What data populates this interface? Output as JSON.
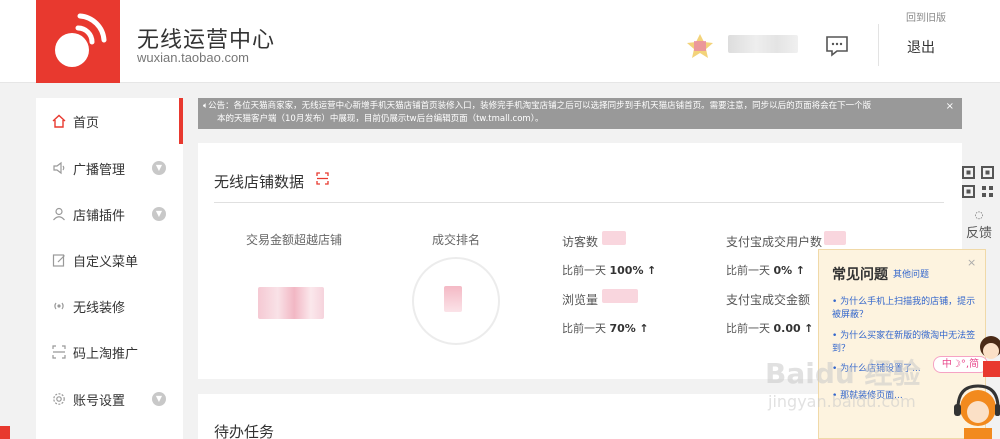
{
  "header": {
    "brand_title": "无线运营中心",
    "brand_sub": "wuxian.taobao.com",
    "old_version": "回到旧版",
    "logout": "退出",
    "brand_color": "#e8392f"
  },
  "sidebar": {
    "items": [
      {
        "label": "首页",
        "icon": "home-icon",
        "active": true,
        "arrow": false
      },
      {
        "label": "广播管理",
        "icon": "speaker-icon",
        "active": false,
        "arrow": true
      },
      {
        "label": "店铺插件",
        "icon": "user-icon",
        "active": false,
        "arrow": true
      },
      {
        "label": "自定义菜单",
        "icon": "edit-icon",
        "active": false,
        "arrow": false
      },
      {
        "label": "无线装修",
        "icon": "wireless-icon",
        "active": false,
        "arrow": false
      },
      {
        "label": "码上淘推广",
        "icon": "scan-icon",
        "active": false,
        "arrow": false
      },
      {
        "label": "账号设置",
        "icon": "gear-icon",
        "active": false,
        "arrow": true
      }
    ]
  },
  "notice": {
    "icon": "speaker-icon",
    "line1": "公告：各位天猫商家家，无线运营中心新增手机天猫店铺首页装修入口，装修完手机淘宝店铺之后可以选择同步到手机天猫店铺首页。需要注意，同步以后的页面将会在下一个版",
    "line2": "本的天猫客户端（10月发布）中展现，目前仍展示tw后台编辑页面（tw.tmall.com）。",
    "close": "×"
  },
  "store_data": {
    "title": "无线店铺数据",
    "exceed_title": "交易金额超越店铺",
    "rank_title": "成交排名",
    "metrics": [
      {
        "label": "访客数",
        "cmp_prefix": "比前一天",
        "cmp_value": "100%",
        "arrow": "↑"
      },
      {
        "label": "支付宝成交用户数",
        "cmp_prefix": "比前一天",
        "cmp_value": "0%",
        "arrow": "↑"
      },
      {
        "label": "浏览量",
        "cmp_prefix": "比前一天",
        "cmp_value": "70%",
        "arrow": "↑"
      },
      {
        "label": "支付宝成交金额",
        "cmp_prefix": "比前一天",
        "cmp_value": "0.00",
        "arrow": "↑"
      }
    ]
  },
  "todo": {
    "title": "待办任务"
  },
  "side_tools": {
    "feedback_label": "反馈"
  },
  "faq": {
    "title": "常见问题",
    "more": "其他问题",
    "close": "×",
    "items": [
      "为什么手机上扫描我的店铺，提示被屏蔽？",
      "为什么买家在新版的微淘中无法签到？",
      "为什么店铺设置了...",
      "那就装修页面..."
    ]
  },
  "ime": {
    "label": "中☽°,简"
  },
  "watermark": {
    "main": "Baidu 经验",
    "sub": "jingyan.baidu.com"
  }
}
